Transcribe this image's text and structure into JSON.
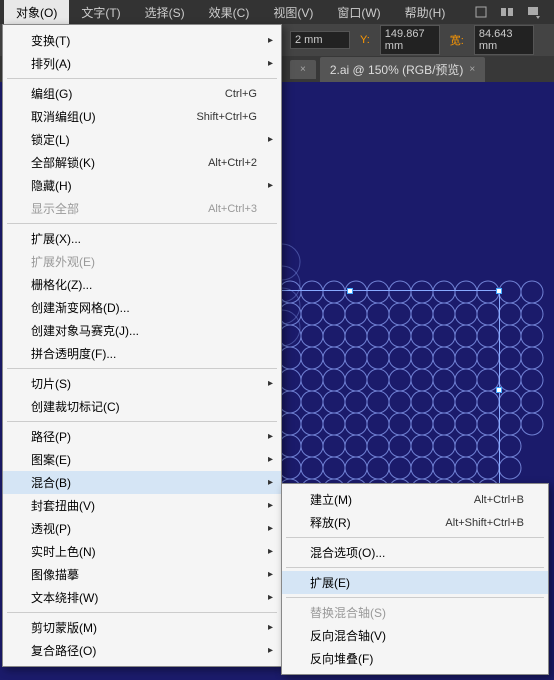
{
  "menubar": {
    "items": [
      "对象(O)",
      "文字(T)",
      "选择(S)",
      "效果(C)",
      "视图(V)",
      "窗口(W)",
      "帮助(H)"
    ],
    "active_index": 0
  },
  "control_bar": {
    "v1": "2 mm",
    "y_label": "Y:",
    "y_val": "149.867 mm",
    "w_label": "宽:",
    "w_val": "84.643 mm"
  },
  "tabs": {
    "active": {
      "label": "2.ai @ 150% (RGB/预览)"
    }
  },
  "dropdown": [
    {
      "type": "item",
      "label": "变换(T)",
      "sub": true
    },
    {
      "type": "item",
      "label": "排列(A)",
      "sub": true
    },
    {
      "type": "sep"
    },
    {
      "type": "item",
      "label": "编组(G)",
      "shortcut": "Ctrl+G"
    },
    {
      "type": "item",
      "label": "取消编组(U)",
      "shortcut": "Shift+Ctrl+G"
    },
    {
      "type": "item",
      "label": "锁定(L)",
      "sub": true
    },
    {
      "type": "item",
      "label": "全部解锁(K)",
      "shortcut": "Alt+Ctrl+2"
    },
    {
      "type": "item",
      "label": "隐藏(H)",
      "sub": true
    },
    {
      "type": "item",
      "label": "显示全部",
      "shortcut": "Alt+Ctrl+3",
      "disabled": true
    },
    {
      "type": "sep"
    },
    {
      "type": "item",
      "label": "扩展(X)..."
    },
    {
      "type": "item",
      "label": "扩展外观(E)",
      "disabled": true
    },
    {
      "type": "item",
      "label": "栅格化(Z)..."
    },
    {
      "type": "item",
      "label": "创建渐变网格(D)..."
    },
    {
      "type": "item",
      "label": "创建对象马赛克(J)..."
    },
    {
      "type": "item",
      "label": "拼合透明度(F)..."
    },
    {
      "type": "sep"
    },
    {
      "type": "item",
      "label": "切片(S)",
      "sub": true
    },
    {
      "type": "item",
      "label": "创建裁切标记(C)"
    },
    {
      "type": "sep"
    },
    {
      "type": "item",
      "label": "路径(P)",
      "sub": true
    },
    {
      "type": "item",
      "label": "图案(E)",
      "sub": true
    },
    {
      "type": "item",
      "label": "混合(B)",
      "sub": true,
      "hover": true
    },
    {
      "type": "item",
      "label": "封套扭曲(V)",
      "sub": true
    },
    {
      "type": "item",
      "label": "透视(P)",
      "sub": true
    },
    {
      "type": "item",
      "label": "实时上色(N)",
      "sub": true
    },
    {
      "type": "item",
      "label": "图像描摹",
      "sub": true
    },
    {
      "type": "item",
      "label": "文本绕排(W)",
      "sub": true
    },
    {
      "type": "sep"
    },
    {
      "type": "item",
      "label": "剪切蒙版(M)",
      "sub": true
    },
    {
      "type": "item",
      "label": "复合路径(O)",
      "sub": true
    }
  ],
  "submenu": [
    {
      "type": "item",
      "label": "建立(M)",
      "shortcut": "Alt+Ctrl+B"
    },
    {
      "type": "item",
      "label": "释放(R)",
      "shortcut": "Alt+Shift+Ctrl+B"
    },
    {
      "type": "sep"
    },
    {
      "type": "item",
      "label": "混合选项(O)..."
    },
    {
      "type": "sep"
    },
    {
      "type": "item",
      "label": "扩展(E)",
      "hover": true
    },
    {
      "type": "sep"
    },
    {
      "type": "item",
      "label": "替换混合轴(S)",
      "disabled": true
    },
    {
      "type": "item",
      "label": "反向混合轴(V)"
    },
    {
      "type": "item",
      "label": "反向堆叠(F)"
    }
  ]
}
